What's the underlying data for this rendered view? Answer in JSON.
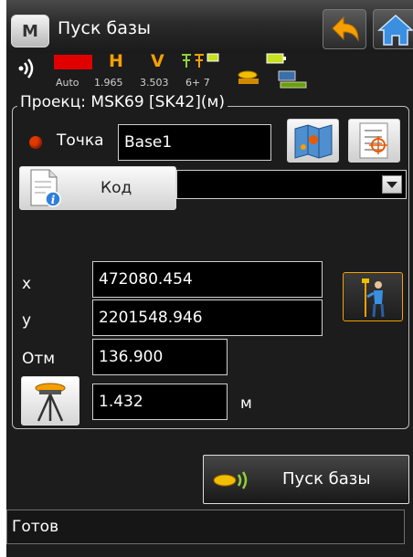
{
  "title_bar": {
    "menu_label": "M",
    "title": "Пуск базы"
  },
  "status": {
    "mode": "Auto",
    "h_value": "1.965",
    "v_value": "3.503",
    "sats": "6+ 7",
    "h_letter": "H",
    "v_letter": "V"
  },
  "projection": {
    "label": "Проекц: MSK69 [SK42](м)"
  },
  "point": {
    "label": "Точка",
    "value": "Base1",
    "indicator_color": "#e03a00"
  },
  "code": {
    "button_label": "Код",
    "dropdown_value": ""
  },
  "coords": {
    "x_label": "x",
    "x_value": "472080.454",
    "y_label": "y",
    "y_value": "2201548.946",
    "h_label": "Отм",
    "h_value": "136.900"
  },
  "antenna": {
    "height_value": "1.432",
    "unit": "м"
  },
  "actions": {
    "start_base_label": "Пуск базы"
  },
  "statusbar": {
    "text": "Готов"
  },
  "colors": {
    "background": "#1c1c1c",
    "accent": "#f5a000",
    "alert": "#e00000"
  }
}
